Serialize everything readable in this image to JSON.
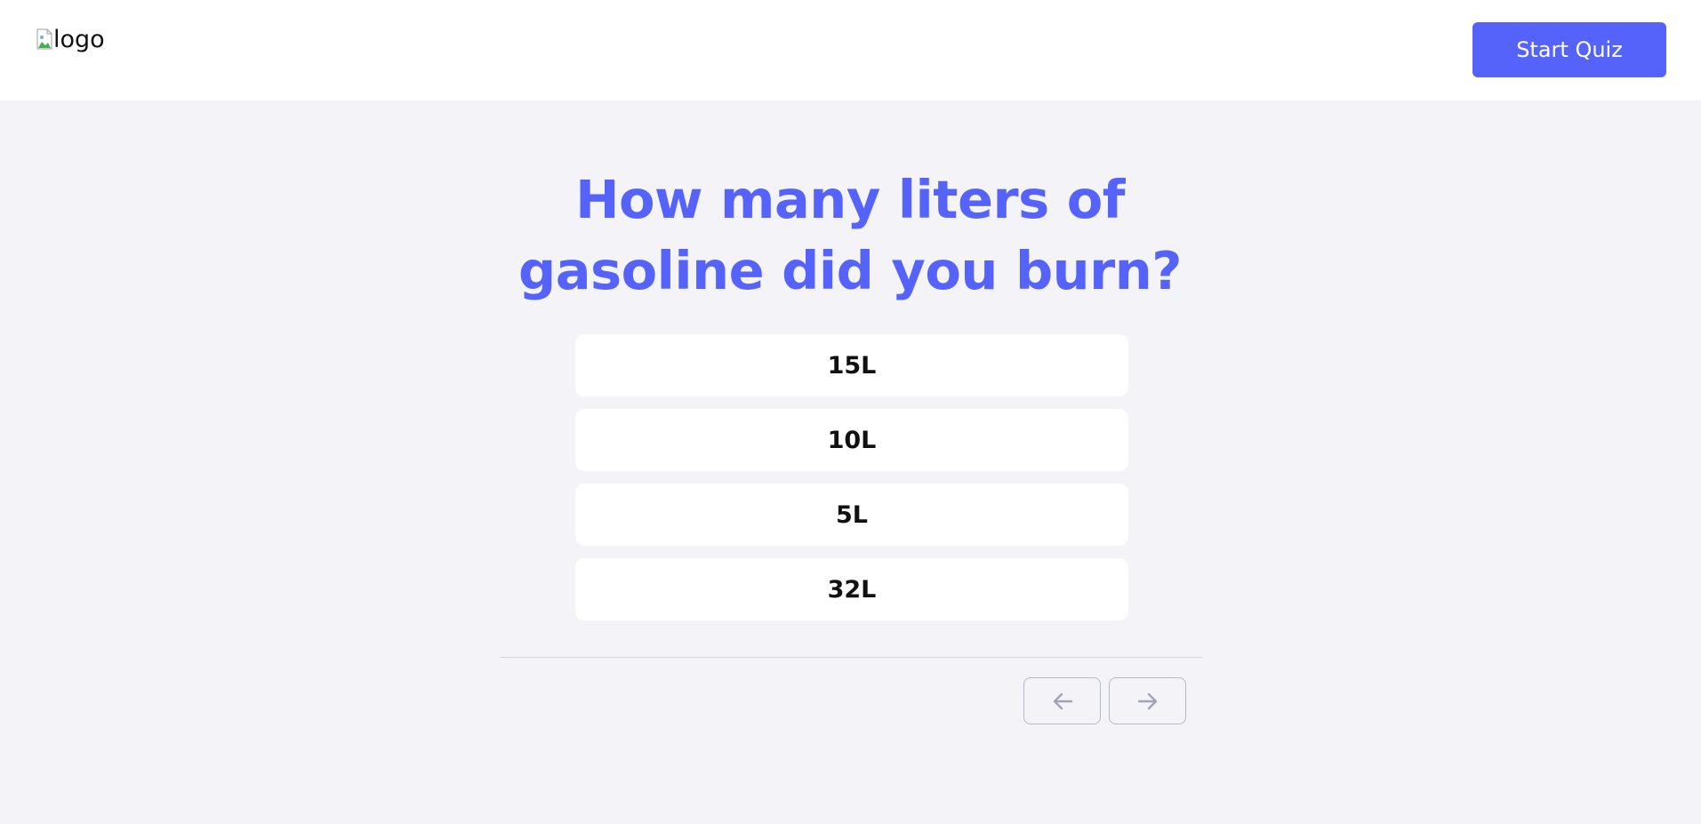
{
  "header": {
    "logo_alt": "logo",
    "start_button_label": "Start Quiz"
  },
  "question": {
    "line1": "How many liters of",
    "line2": "gasoline did you burn?"
  },
  "options": [
    "15L",
    "10L",
    "5L",
    "32L"
  ],
  "navigation": {
    "prev_icon": "arrow-left-icon",
    "next_icon": "arrow-right-icon"
  },
  "colors": {
    "accent": "#5563fa",
    "background": "#f3f3f8",
    "card": "#ffffff",
    "nav_border": "#b5b9c6",
    "nav_icon": "#a0a5b5"
  }
}
